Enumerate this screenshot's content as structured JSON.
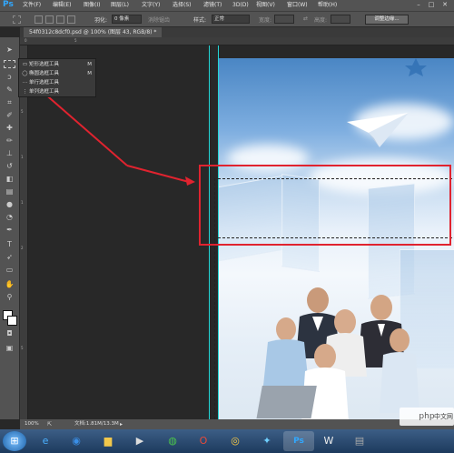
{
  "app": {
    "logo": "Ps"
  },
  "menu": [
    "文件(F)",
    "编辑(E)",
    "图像(I)",
    "图层(L)",
    "文字(Y)",
    "选择(S)",
    "滤镜(T)",
    "3D(D)",
    "视图(V)",
    "窗口(W)",
    "帮助(H)"
  ],
  "window_controls": [
    "–",
    "□",
    "✕"
  ],
  "options": {
    "feather_label": "羽化:",
    "feather_value": "0 像素",
    "antialias_label": "消除锯齿",
    "style_label": "样式:",
    "style_value": "正常",
    "width_label": "宽度:",
    "height_label": "高度:",
    "adjust_button": "调整边缘..."
  },
  "document_tab": "54f0312c8dcf0.psd @ 100% (图层 43, RGB/8) *",
  "flyout": [
    {
      "label": "矩形选框工具",
      "key": "M",
      "icon": "rect-marquee-icon",
      "glyph": "▭"
    },
    {
      "label": "椭圆选框工具",
      "key": "M",
      "icon": "ellipse-marquee-icon",
      "glyph": "◯"
    },
    {
      "label": "单行选框工具",
      "key": "",
      "icon": "single-row-icon",
      "glyph": "⋯"
    },
    {
      "label": "单列选框工具",
      "key": "",
      "icon": "single-col-icon",
      "glyph": "⋮"
    }
  ],
  "ruler_top": [
    "0",
    "5"
  ],
  "ruler_left": [
    "0",
    "5",
    "1",
    "1",
    "2",
    "5"
  ],
  "status": {
    "zoom": "100%",
    "doc_size": "文档:1.81M/13.3M"
  },
  "watermark": {
    "text": "php",
    "cn": "中文网"
  },
  "colors": {
    "guide": "#22d6d6",
    "annotation": "#e0232f",
    "ps_blue": "#31a8ff"
  }
}
